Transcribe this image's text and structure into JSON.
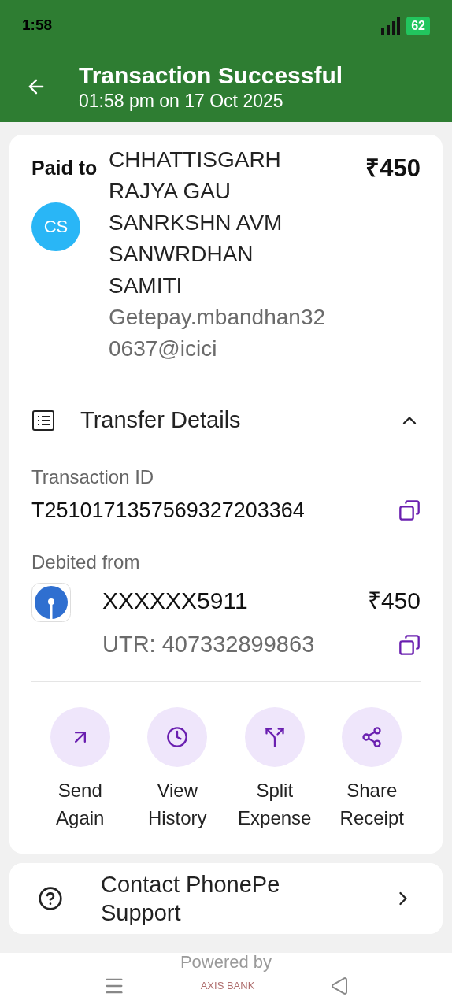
{
  "status_bar": {
    "time": "1:58",
    "battery": "62"
  },
  "header": {
    "title": "Transaction Successful",
    "subtitle": "01:58 pm on 17 Oct 2025"
  },
  "payee": {
    "label": "Paid to",
    "initials": "CS",
    "name": "CHHATTISGARH RAJYA GAU SANRKSHN AVM SANWRDHAN SAMITI",
    "upi_id": "Getepay.mbandhan320637@icici",
    "amount": "₹450"
  },
  "transfer_details": {
    "title": "Transfer Details",
    "expanded": true,
    "transaction_id_label": "Transaction ID",
    "transaction_id": "T2510171357569327203364",
    "debited_label": "Debited from",
    "account": "XXXXXX5911",
    "amount": "₹450",
    "utr": "UTR: 407332899863"
  },
  "actions": [
    {
      "kind": "send",
      "label": "Send Again"
    },
    {
      "kind": "history",
      "label": "View History"
    },
    {
      "kind": "split",
      "label": "Split Expense"
    },
    {
      "kind": "share",
      "label": "Share Receipt"
    }
  ],
  "support": {
    "label": "Contact PhonePe Support"
  },
  "footer": {
    "powered_by": "Powered by",
    "bank": "AXIS BANK"
  }
}
